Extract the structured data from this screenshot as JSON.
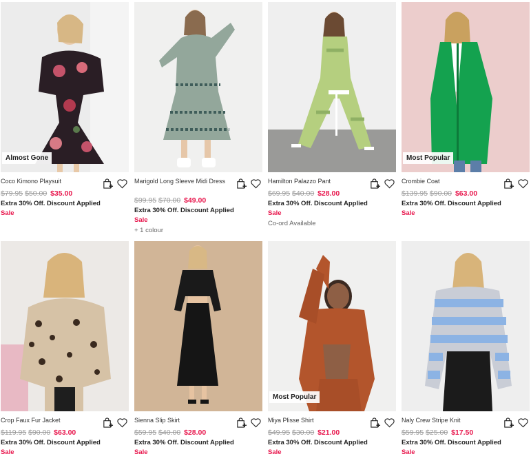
{
  "colors": {
    "sale": "#e8174d",
    "was": "#9a9a9a",
    "text": "#222222"
  },
  "products": [
    {
      "name": "Coco Kimono Playsuit",
      "was": [
        "$79.95",
        "$50.00"
      ],
      "now": "$35.00",
      "promo": "Extra 30% Off. Discount Applied",
      "sale": "Sale",
      "badge": "Almost Gone",
      "note": ""
    },
    {
      "name": "Marigold Long Sleeve Midi Dress",
      "was": [
        "$99.95",
        "$70.00"
      ],
      "now": "$49.00",
      "promo": "Extra 30% Off. Discount Applied",
      "sale": "Sale",
      "badge": "",
      "note": "+ 1 colour"
    },
    {
      "name": "Hamilton Palazzo Pant",
      "was": [
        "$69.95",
        "$40.00"
      ],
      "now": "$28.00",
      "promo": "Extra 30% Off. Discount Applied",
      "sale": "Sale",
      "badge": "",
      "note": "Co-ord Available"
    },
    {
      "name": "Crombie Coat",
      "was": [
        "$139.95",
        "$90.00"
      ],
      "now": "$63.00",
      "promo": "Extra 30% Off. Discount Applied",
      "sale": "Sale",
      "badge": "Most Popular",
      "note": ""
    },
    {
      "name": "Crop Faux Fur Jacket",
      "was": [
        "$119.95",
        "$90.00"
      ],
      "now": "$63.00",
      "promo": "Extra 30% Off. Discount Applied",
      "sale": "Sale",
      "badge": "",
      "note": ""
    },
    {
      "name": "Sienna Slip Skirt",
      "was": [
        "$59.95",
        "$40.00"
      ],
      "now": "$28.00",
      "promo": "Extra 30% Off. Discount Applied",
      "sale": "Sale",
      "badge": "",
      "note": ""
    },
    {
      "name": "Miya Plisse Shirt",
      "was": [
        "$49.95",
        "$30.00"
      ],
      "now": "$21.00",
      "promo": "Extra 30% Off. Discount Applied",
      "sale": "Sale",
      "badge": "Most Popular",
      "note": ""
    },
    {
      "name": "Naly Crew Stripe Knit",
      "was": [
        "$59.95",
        "$25.00"
      ],
      "now": "$17.50",
      "promo": "Extra 30% Off. Discount Applied",
      "sale": "Sale",
      "badge": "",
      "note": ""
    }
  ],
  "icons": {
    "bag": "add-to-bag-icon",
    "wishlist": "heart-icon"
  }
}
